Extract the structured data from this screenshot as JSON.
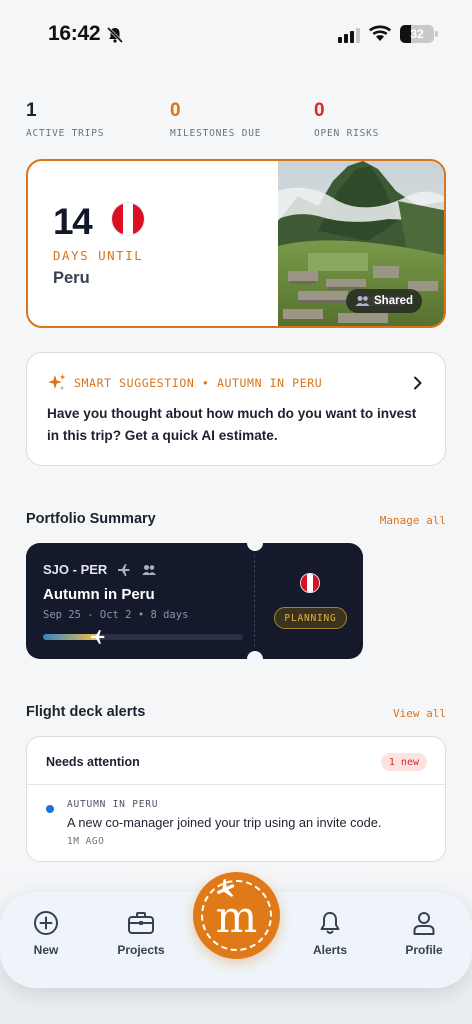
{
  "status_bar": {
    "time": "16:42",
    "battery": "32"
  },
  "stats": [
    {
      "value": "1",
      "label": "ACTIVE TRIPS",
      "color": "#1c2230"
    },
    {
      "value": "0",
      "label": "MILESTONES DUE",
      "color": "#d9741a"
    },
    {
      "value": "0",
      "label": "OPEN RISKS",
      "color": "#dc2626"
    }
  ],
  "hero": {
    "days": "14",
    "days_label": "DAYS UNTIL",
    "destination": "Peru",
    "shared_label": "Shared",
    "accent": "#d9741a"
  },
  "suggestion": {
    "title": "SMART SUGGESTION • AUTUMN IN PERU",
    "body": "Have you thought about how much do you want to invest in this trip? Get a quick AI estimate."
  },
  "portfolio": {
    "title": "Portfolio Summary",
    "link": "Manage all",
    "trip": {
      "route": "SJO - PER",
      "name": "Autumn in Peru",
      "dates": "Sep 25 - Oct 2 • 8 days",
      "status": "PLANNING",
      "progress": 0.28
    }
  },
  "alerts": {
    "title": "Flight deck alerts",
    "link": "View all",
    "panel_title": "Needs attention",
    "new_badge": "1 new",
    "items": [
      {
        "trip": "AUTUMN IN PERU",
        "message": "A new co-manager joined your trip using an invite code.",
        "time": "1M AGO"
      }
    ]
  },
  "nav": {
    "items": [
      {
        "label": "New",
        "icon": "plus-circle-icon"
      },
      {
        "label": "Projects",
        "icon": "briefcase-icon"
      },
      {
        "label": "Alerts",
        "icon": "bell-icon"
      },
      {
        "label": "Profile",
        "icon": "user-icon"
      }
    ],
    "fab_icon": "logo-m-icon",
    "fab_color": "#e07a18"
  }
}
